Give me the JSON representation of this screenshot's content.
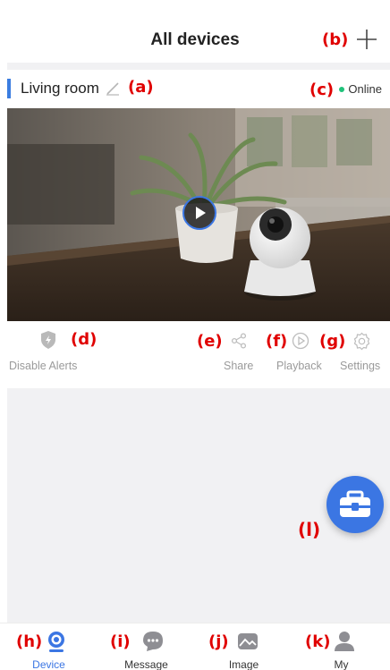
{
  "header": {
    "title": "All devices",
    "add_icon": "plus-icon"
  },
  "callouts": {
    "a": "(a)",
    "b": "(b)",
    "c": "(c)",
    "d": "(d)",
    "e": "(e)",
    "f": "(f)",
    "g": "(g)",
    "h": "(h)",
    "i": "(i)",
    "j": "(j)",
    "k": "(k)",
    "l": "(l)"
  },
  "device": {
    "name": "Living room",
    "status": "Online",
    "colors": {
      "accent": "#3b7de0",
      "online": "#1fc27a"
    }
  },
  "actions": {
    "disable_alerts": "Disable Alerts",
    "share": "Share",
    "playback": "Playback",
    "settings": "Settings"
  },
  "tabs": [
    {
      "label": "Device",
      "icon": "camera-icon",
      "active": true
    },
    {
      "label": "Message",
      "icon": "chat-bubble-icon",
      "active": false
    },
    {
      "label": "Image",
      "icon": "image-icon",
      "active": false
    },
    {
      "label": "My",
      "icon": "person-icon",
      "active": false
    }
  ],
  "fab": {
    "icon": "toolbox-icon",
    "color": "#3b76e3"
  }
}
